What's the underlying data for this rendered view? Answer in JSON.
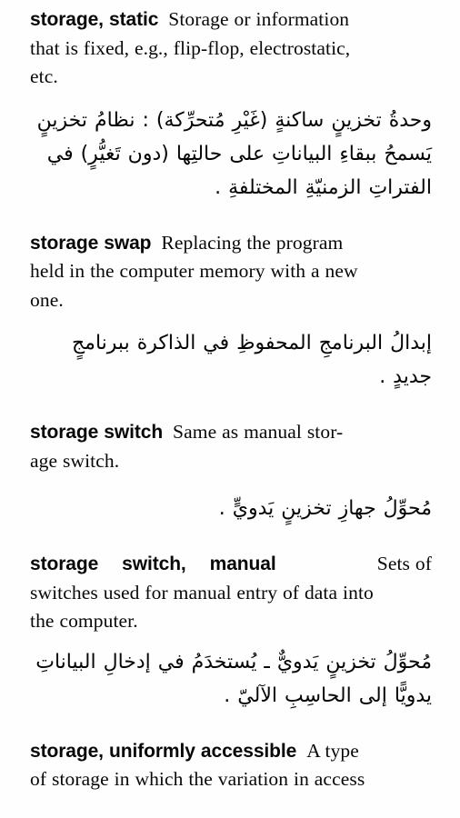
{
  "page": {
    "kind": "bilingual-dictionary-page",
    "language_pair": "English-Arabic",
    "background_color": "#fefefe",
    "text_color": "#080808"
  },
  "entries": [
    {
      "id": "storage-static",
      "headword": "storage, static",
      "definition_lines": [
        "Storage or information",
        "that is fixed, e.g., flip-flop, electrostatic,",
        "etc."
      ],
      "definition_full": "Storage or information that is fixed, e.g., flip-flop, electrostatic, etc.",
      "arabic_lines": [
        "وحدةُ تخزينٍ ساكنةٍ (غَيْرِ مُتحرِّكة) : نظامُ تخزينٍ",
        "يَسمحُ ببقاءِ البياناتِ على حالتِها (دون تَغيُّرٍ) في",
        "الفتراتِ الزمنيّةِ المختلفةِ ."
      ],
      "arabic_full": "وحدةُ تخزينٍ ساكنةٍ (غَيْرِ مُتحرِّكة) : نظامُ تخزينٍ يَسمحُ ببقاءِ البياناتِ على حالتِها (دون تَغيُّرٍ) في الفتراتِ الزمنيّةِ المختلفةِ ."
    },
    {
      "id": "storage-swap",
      "headword": "storage swap",
      "definition_lines": [
        "Replacing the program",
        "held in the computer memory with a new",
        "one."
      ],
      "definition_full": "Replacing the program held in the computer memory with a new one.",
      "arabic_lines": [
        "إبدالُ البرنامجِ المحفوظِ في الذاكرة ببرنامجٍ",
        "جديدٍ ."
      ],
      "arabic_full": "إبدالُ البرنامجِ المحفوظِ في الذاكرة ببرنامجٍ جديدٍ ."
    },
    {
      "id": "storage-switch",
      "headword": "storage switch",
      "definition_lines": [
        "Same as manual stor-",
        "age switch."
      ],
      "definition_full": "Same as manual storage switch.",
      "arabic_lines": [
        "مُحوِّلُ جهازِ تخزينٍ يَدويٍّ ."
      ],
      "arabic_full": "مُحوِّلُ جهازِ تخزينٍ يَدويٍّ ."
    },
    {
      "id": "storage-switch-manual",
      "headword_parts": [
        "storage",
        "switch,",
        "manual"
      ],
      "headword": "storage switch, manual",
      "definition_lines": [
        "Sets of",
        "switches used for manual entry of data into",
        "the computer."
      ],
      "definition_full": "Sets of switches used for manual entry of data into the computer.",
      "arabic_lines": [
        "مُحوِّلُ تخزينٍ يَدويٌّ ـ يُستخدَمُ في إدخالِ البياناتِ",
        "يدويًّا إلى الحاسِبِ الآليّ ."
      ],
      "arabic_full": "مُحوِّلُ تخزينٍ يَدويٌّ ـ يُستخدَمُ في إدخالِ البياناتِ يدويًّا إلى الحاسِبِ الآليّ ."
    },
    {
      "id": "storage-uniformly-accessible",
      "headword": "storage, uniformly accessible",
      "definition_lines": [
        "A type",
        "of storage in which the variation in access"
      ],
      "definition_full": "A type of storage in which the variation in access",
      "arabic_lines": [],
      "arabic_full": ""
    }
  ]
}
